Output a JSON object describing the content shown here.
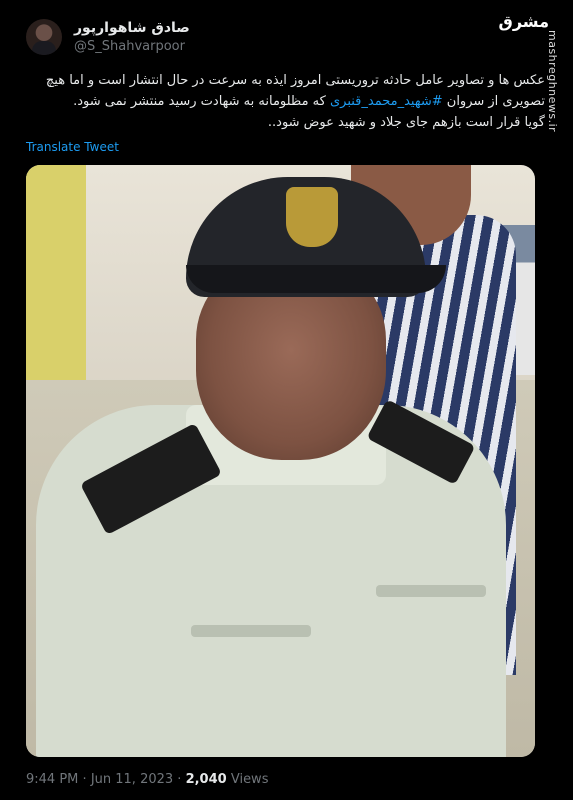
{
  "author": {
    "name": "صادق شاهوارپور",
    "handle": "@S_Shahvarpoor"
  },
  "watermark": {
    "logo": "مشرق",
    "url": "mashreghnews.ir"
  },
  "tweet": {
    "line1": "عکس ها و تصاویر عامل حادثه تروریستی امروز ایذه به سرعت در حال انتشار است و اما هیچ",
    "line2_before": "تصویری از سروان",
    "hashtag": "#شهید_محمد_قنبری",
    "line2_after": "که مظلومانه به شهادت رسید منتشر نمی شود.",
    "line3": "گویا قرار است بازهم جای جلاد و شهید عوض شود..",
    "translate_label": "Translate Tweet"
  },
  "meta": {
    "time": "9:44 PM",
    "sep1": "·",
    "date": "Jun 11, 2023",
    "sep2": "·",
    "views_count": "2,040",
    "views_label": "Views"
  },
  "colors": {
    "background": "#000000",
    "text": "#e7e9ea",
    "secondary": "#71767b",
    "link": "#1d9bf0"
  }
}
